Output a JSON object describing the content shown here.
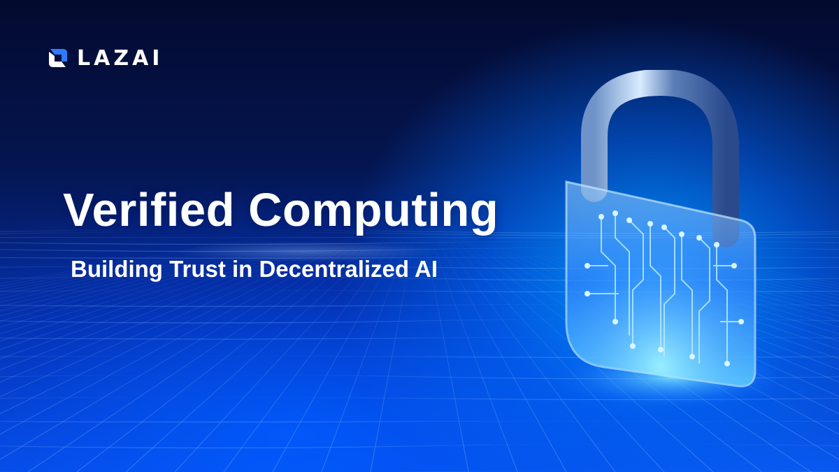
{
  "brand": {
    "logo_text": "LAZAI",
    "logo_icon": "lazai-logo-mark"
  },
  "hero": {
    "title": "Verified Computing",
    "subtitle": "Building Trust in Decentralized AI"
  },
  "illustration": {
    "icon": "padlock-circuit-icon"
  },
  "colors": {
    "background_dark": "#04103d",
    "background_bright": "#0a56f0",
    "glow": "#0096ff",
    "text": "#ffffff",
    "logo_accent": "#2f7bff"
  }
}
